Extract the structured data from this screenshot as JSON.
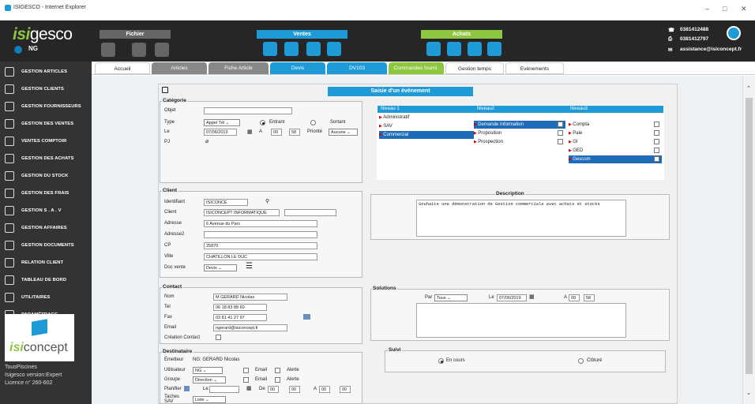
{
  "window": {
    "title": "ISIGESCO - Internet Explorer"
  },
  "header": {
    "logo_a": "isi",
    "logo_b": "gesco",
    "user": "NG",
    "sections": {
      "fichier": "Fichier",
      "ventes": "Ventes",
      "achats": "Achats"
    },
    "phone1": "0381412488",
    "phone2": "0381412797",
    "email": "assistance@isiconcept.fr"
  },
  "sidebar": {
    "items": [
      "GESTION ARTICLES",
      "GESTION CLIENTS",
      "GESTION FOURNISSEURS",
      "GESTION DES VENTES",
      "VENTES COMPTOIR",
      "GESTION DES ACHATS",
      "GESTION DU STOCK",
      "GESTION DES FRAIS",
      "GESTION S . A . V",
      "GESTION AFFAIRES",
      "GESTION DOCUMENTS",
      "RELATION CLIENT",
      "TABLEAU DE BORD",
      "UTILITAIRES",
      "PARAMÉTRAGE",
      "INFORMATION"
    ],
    "promo_a": "isi",
    "promo_b": "concept",
    "company": "TousPiscines",
    "version": "Isigesco version:Expert",
    "licence": "Licence n° 260-602"
  },
  "tabs": [
    "Accueil",
    "Articles",
    "Fiche Article",
    "Devis",
    "DV103",
    "Commandes fourni·",
    "Gestion temps",
    "Evènements"
  ],
  "form": {
    "title": "Saisie d'un événement",
    "categorie": {
      "legend": "Catégorie",
      "objet_label": "Objet",
      "objet_value": "",
      "type_label": "Type",
      "type_value": "Appel Tél",
      "entrant": "Entrant",
      "sortant": "Sortant",
      "le_label": "Le",
      "date": "07/06/2019",
      "a_label": "A",
      "hour": "09",
      "min": "58",
      "priorite_label": "Priorité",
      "priorite_value": "Aucune",
      "pj_label": "PJ"
    },
    "niveaux": {
      "headers": [
        "Niveau 1",
        "Niveau2",
        "Niveau3"
      ],
      "n1": [
        "Administratif",
        "SAV",
        "Commercial"
      ],
      "n2": [
        "Demande Information",
        "Proposition",
        "Prospection"
      ],
      "n3": [
        "Compta",
        "Paie",
        "GI",
        "GED",
        "Gescom"
      ]
    },
    "client": {
      "legend": "Client",
      "identifiant_label": "Identifiant",
      "identifiant": "ISICONCE",
      "client_label": "Client",
      "client": "ISICONCEPT INFORMATIQUE",
      "adresse_label": "Adresse",
      "adresse": "6 Avenue du Parc",
      "adresse2_label": "Adresse2",
      "adresse2": "",
      "cp_label": "CP",
      "cp": "25870",
      "ville_label": "Ville",
      "ville": "CHATILLON LE DUC",
      "doc_label": "Doc vente",
      "doc_value": "Devis"
    },
    "description": {
      "legend": "Description",
      "text": "Souhaite une démonstration de Gestion commerciale avec achats et stocks"
    },
    "contact": {
      "legend": "Contact",
      "nom_label": "Nom",
      "nom": "M GERARD Nicolas",
      "tel_label": "Tel",
      "tel": "06 18 83 88 60",
      "fax_label": "Fax",
      "fax": "03 81 41 27 97",
      "email_label": "Email",
      "email": "ngerard@isiconcept.fr",
      "creation_label": "Création Contact"
    },
    "solutions": {
      "legend": "Solutions",
      "par_label": "Par",
      "par_value": "Tous",
      "le_label": "Le",
      "date": "07/06/2019",
      "a_label": "A",
      "hour": "09",
      "min": "58"
    },
    "destinataire": {
      "legend": "Destinataire",
      "emetteur_label": "Émetteur",
      "emetteur": "NG: GERARD Nicolas",
      "utilisateur_label": "Utilisateur",
      "utilisateur": "NG",
      "groupe_label": "Groupe",
      "groupe": "Direction",
      "email_label": "Email",
      "alerte_label": "Alerte",
      "planifier_label": "Planifier",
      "le_label": "Le",
      "de_label": "De",
      "de_h": "00",
      "de_m": "00",
      "a_label": "A",
      "a_h": "00",
      "a_m": "00",
      "taches_label": "Taches SAV",
      "taches_value": "Liste"
    },
    "suivi": {
      "legend": "Suivi",
      "en_cours": "En cours",
      "cloture": "Clôturé"
    }
  },
  "colors": {
    "accent": "#1e9ad6",
    "green": "#8dc63f",
    "dark": "#333333"
  }
}
